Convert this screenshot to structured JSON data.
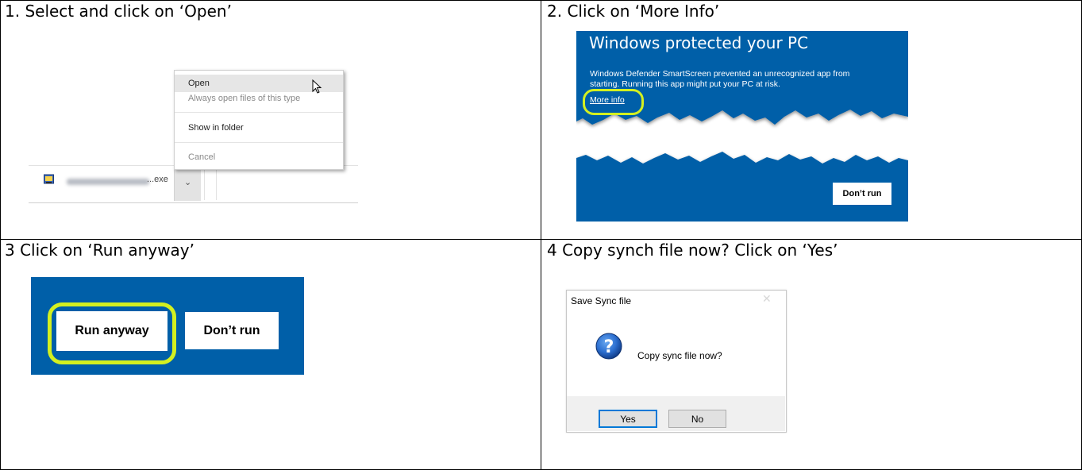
{
  "steps": [
    {
      "caption": "1. Select and click on ‘Open’"
    },
    {
      "caption": "2. Click on ‘More Info’"
    },
    {
      "caption": "3 Click on ‘Run anyway’"
    },
    {
      "caption": "4 Copy synch file now? Click on ‘Yes’"
    }
  ],
  "download_menu": {
    "items": [
      "Open",
      "Always open files of this type",
      "Show in folder",
      "Cancel"
    ],
    "file_suffix": "...exe"
  },
  "smartscreen": {
    "title": "Windows protected your PC",
    "body": "Windows Defender SmartScreen prevented an unrecognized app from starting. Running this app might put your PC at risk.",
    "more_info": "More info",
    "dont_run": "Don’t run",
    "bg_color": "#005fa8"
  },
  "run_panel": {
    "run_anyway": "Run anyway",
    "dont_run": "Don’t run",
    "highlight_color": "#d3f020"
  },
  "sync_dialog": {
    "title": "Save Sync file",
    "close": "✕",
    "message": "Copy sync file now?",
    "yes": "Yes",
    "no": "No"
  }
}
